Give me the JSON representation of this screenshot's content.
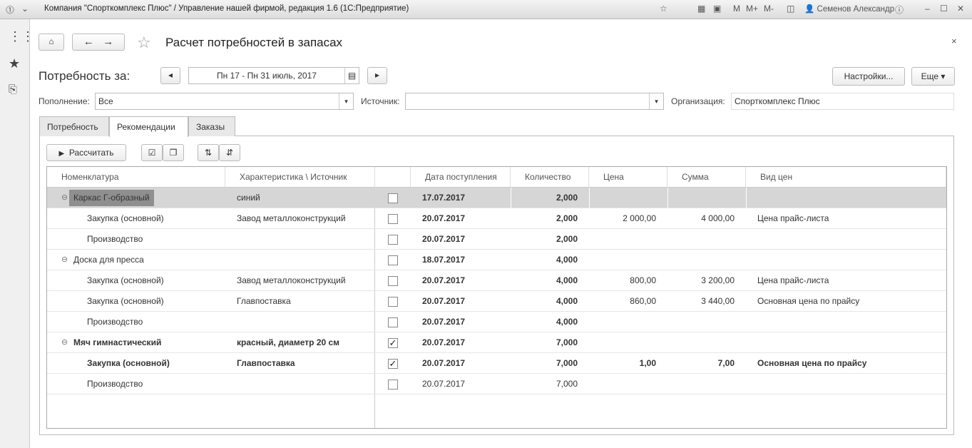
{
  "window": {
    "title": "Компания \"Спорткомплекс Плюс\" / Управление нашей фирмой, редакция 1.6  (1С:Предприятие)",
    "user": "Семенов Александр",
    "memory": [
      "M",
      "M+",
      "M-"
    ]
  },
  "page": {
    "title": "Расчет потребностей в запасах",
    "period_label": "Потребность за:",
    "period": "Пн 17 - Пн 31 июль, 2017",
    "settings": "Настройки...",
    "more": "Еще"
  },
  "filters": {
    "replenishment_label": "Пополнение:",
    "replenishment": "Все",
    "source_label": "Источник:",
    "source": "",
    "org_label": "Организация:",
    "org": "Спорткомплекс Плюс"
  },
  "tabs": [
    "Потребность",
    "Рекомендации",
    "Заказы"
  ],
  "toolbar": {
    "calculate": "Рассчитать"
  },
  "table": {
    "headers": [
      "Номенклатура",
      "Характеристика \\ Источник",
      "",
      "Дата поступления",
      "Количество",
      "Цена",
      "Сумма",
      "Вид цен"
    ],
    "rows": [
      {
        "level": 0,
        "name": "Каркас Г-образный",
        "char": "синий",
        "checked": false,
        "date": "17.07.2017",
        "qty": "2,000",
        "price": "",
        "sum": "",
        "ptype": "",
        "bold": false,
        "selected": true
      },
      {
        "level": 1,
        "name": "Закупка (основной)",
        "char": "Завод металлоконструкций",
        "checked": false,
        "date": "20.07.2017",
        "qty": "2,000",
        "price": "2 000,00",
        "sum": "4 000,00",
        "ptype": "Цена прайс-листа",
        "bold": false
      },
      {
        "level": 1,
        "name": "Производство",
        "char": "",
        "checked": false,
        "date": "20.07.2017",
        "qty": "2,000",
        "price": "",
        "sum": "",
        "ptype": "",
        "bold": false
      },
      {
        "level": 0,
        "name": "Доска для пресса",
        "char": "",
        "checked": false,
        "date": "18.07.2017",
        "qty": "4,000",
        "price": "",
        "sum": "",
        "ptype": "",
        "bold": false
      },
      {
        "level": 1,
        "name": "Закупка (основной)",
        "char": "Завод металлоконструкций",
        "checked": false,
        "date": "20.07.2017",
        "qty": "4,000",
        "price": "800,00",
        "sum": "3 200,00",
        "ptype": "Цена прайс-листа",
        "bold": false
      },
      {
        "level": 1,
        "name": "Закупка (основной)",
        "char": "Главпоставка",
        "checked": false,
        "date": "20.07.2017",
        "qty": "4,000",
        "price": "860,00",
        "sum": "3 440,00",
        "ptype": "Основная цена по прайсу",
        "bold": false
      },
      {
        "level": 1,
        "name": "Производство",
        "char": "",
        "checked": false,
        "date": "20.07.2017",
        "qty": "4,000",
        "price": "",
        "sum": "",
        "ptype": "",
        "bold": false
      },
      {
        "level": 0,
        "name": "Мяч гимнастический",
        "char": "красный, диаметр 20 см",
        "checked": true,
        "date": "20.07.2017",
        "qty": "7,000",
        "price": "",
        "sum": "",
        "ptype": "",
        "bold": true
      },
      {
        "level": 1,
        "name": "Закупка (основной)",
        "char": "Главпоставка",
        "checked": true,
        "date": "20.07.2017",
        "qty": "7,000",
        "price": "1,00",
        "sum": "7,00",
        "ptype": "Основная цена по прайсу",
        "bold": true
      },
      {
        "level": 1,
        "name": "Производство",
        "char": "",
        "checked": false,
        "date": "20.07.2017",
        "qty": "7,000",
        "price": "",
        "sum": "",
        "ptype": "",
        "bold": false,
        "plain": true
      }
    ]
  }
}
